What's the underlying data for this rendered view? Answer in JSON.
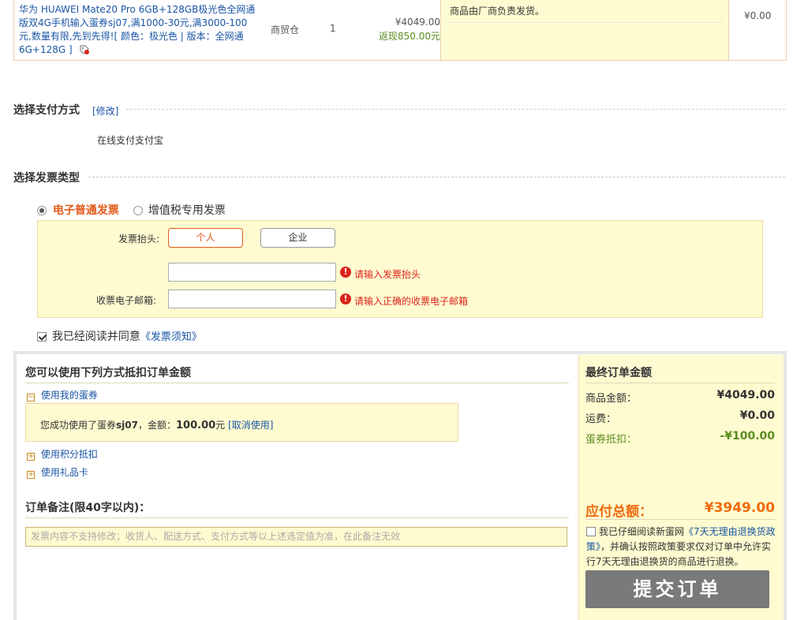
{
  "product": {
    "name": "华为 HUAWEI Mate20 Pro 6GB+128GB极光色全网通版双4G手机输入蛋券sj07,满1000-30元,满3000-100元,数量有限,先到先得!",
    "spec": "[ 颜色：极光色 | 版本：全网通 6G+128G ]",
    "warehouse": "商贸仓",
    "qty": "1",
    "price": "¥4049.00",
    "cashback": "返现850.00元",
    "note": "商品由厂商负责发货。",
    "subtotal": "¥0.00"
  },
  "payment": {
    "title": "选择支付方式",
    "modify": "[修改]",
    "method": "在线支付支付宝"
  },
  "invoice": {
    "title": "选择发票类型",
    "type_electronic": "电子普通发票",
    "type_vat": "增值税专用发票",
    "header_label": "发票抬头:",
    "btn_personal": "个人",
    "btn_company": "企业",
    "err_header": "请输入发票抬头",
    "email_label": "收票电子邮箱:",
    "err_email": "请输入正确的收票电子邮箱",
    "agree_text": "我已经阅读并同意",
    "agree_link": "《发票须知》"
  },
  "discount": {
    "title": "您可以使用下列方式抵扣订单金额",
    "use_coupon": "使用我的蛋券",
    "coupon_msg_prefix": "您成功使用了蛋券",
    "coupon_code": "sj07",
    "coupon_msg_amount_label": "，金额：",
    "coupon_amount": "100.00",
    "coupon_unit": "元",
    "cancel": "[取消使用]",
    "use_points": "使用积分抵扣",
    "use_giftcard": "使用礼品卡"
  },
  "remark": {
    "title": "订单备注(限40字以内)：",
    "placeholder": "发票内容不支持修改；收货人、配送方式、支付方式等以上述选定值为准，在此备注无效"
  },
  "summary": {
    "title": "最终订单金额",
    "goods_label": "商品金额：",
    "goods_value": "¥4049.00",
    "shipping_label": "运费：",
    "shipping_value": "¥0.00",
    "coupon_label": "蛋券抵扣：",
    "coupon_value": "-¥100.00",
    "total_label": "应付总额：",
    "total_value": "¥3949.00",
    "policy_prefix": "我已仔细阅读新蛋网",
    "policy_link": "《7天无理由退换货政策》",
    "policy_suffix": "，并确认按照政策要求仅对订单中允许实行7天无理由退换货的商品进行退换。",
    "submit": "提交订单"
  }
}
